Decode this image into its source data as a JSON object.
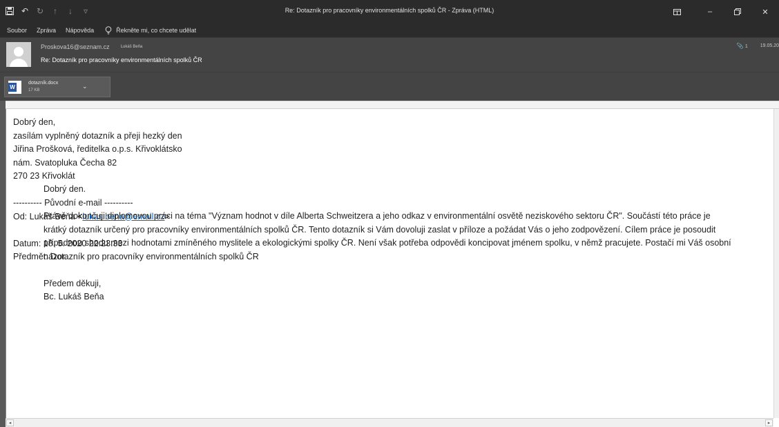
{
  "window": {
    "title": "Re: Dotazník pro pracovníky environmentálních spolků ČR  -  Zpráva (HTML)"
  },
  "qat": {
    "icons": [
      "save-icon",
      "undo-icon",
      "redo-icon",
      "up-arrow-icon",
      "down-arrow-icon",
      "customize-dropdown-icon"
    ]
  },
  "menu": {
    "items": [
      "Soubor",
      "Zpráva",
      "Nápověda"
    ],
    "tell_me": "Řekněte mi, co chcete udělat"
  },
  "header": {
    "sender": "Proskova16@seznam.cz",
    "recipient": "Lukáš Beňa",
    "subject": "Re: Dotazník pro pracovníky environmentálních spolků ČR",
    "attachment_count": "1",
    "date": "19.05.20"
  },
  "attachment": {
    "name": "dotazník.docx",
    "size": "17 KB"
  },
  "body": {
    "lines": [
      "Dobrý den,",
      "zasílám vyplněný dotazník a přeji hezký den",
      "Jiřina Prošková, ředitelka o.p.s. Křivoklátsko",
      "nám. Svatopluka Čecha 82",
      "270 23 Křivoklát"
    ],
    "original_divider": "---------- Původní e-mail ----------",
    "from_label": "Od: Lukáš Beňa <",
    "from_email": "lukas.bena@email.cz",
    "from_close": ">",
    "date_line": "Datum: 18. 5. 2020 22:23:33",
    "subject_line": "Předmět: Dotazník pro pracovníky environmentálních spolků ČR",
    "quote_greeting": "Dobrý den.",
    "quote_paragraph": "Právě dokončuji diplomovou práci na téma \"Význam hodnot v díle Alberta Schweitzera a jeho odkaz v environmentální osvětě neziskového sektoru ČR\". Součástí této práce je krátký dotazník určený pro pracovníky environmentálních spolků ČR. Tento dotazník si Vám dovoluji zaslat v příloze a požádat Vás o jeho zodpovězení. Cílem práce je posoudit případnou shodu mezi hodnotami zmíněného myslitele a ekologickými spolky ČR. Není však potřeba odpovědi koncipovat jménem spolku, v němž pracujete. Postačí mi Váš osobní názor.",
    "quote_thanks": "Předem děkuji,",
    "quote_signature": "Bc. Lukáš Beňa"
  }
}
